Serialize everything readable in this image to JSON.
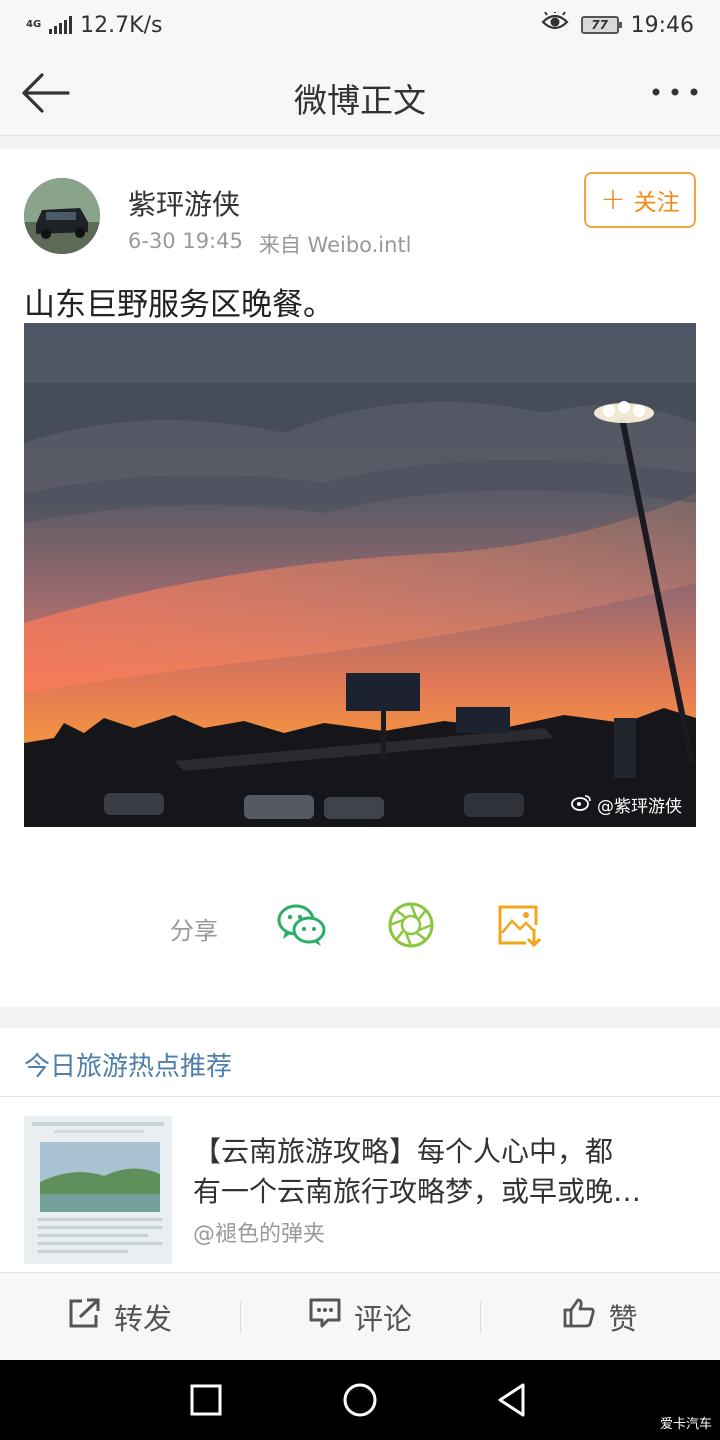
{
  "status_bar": {
    "network_type": "4G",
    "speed": "12.7K/s",
    "battery": "77",
    "time": "19:46"
  },
  "nav": {
    "title": "微博正文"
  },
  "post": {
    "username": "紫玶游侠",
    "time": "6-30 19:45",
    "source": "来自 Weibo.intl",
    "follow_label": "关注",
    "text": "山东巨野服务区晚餐。",
    "watermark": "@紫玶游侠"
  },
  "share": {
    "label": "分享",
    "icons": [
      "wechat-icon",
      "moments-icon",
      "save-image-icon"
    ]
  },
  "recommend": {
    "section_title": "今日旅游热点推荐",
    "line1": "【云南旅游攻略】每个人心中，都",
    "line2": "有一个云南旅行攻略梦，或早或晚…",
    "author": "@褪色的弹夹"
  },
  "actions": {
    "repost": "转发",
    "comment": "评论",
    "like": "赞"
  },
  "corner_mark": "爱卡汽车",
  "colors": {
    "accent_orange": "#f08c16",
    "link_blue": "#4f7fa8",
    "wechat_green": "#2aae67",
    "moments_green": "#8cc640",
    "save_orange": "#f0a51c"
  }
}
